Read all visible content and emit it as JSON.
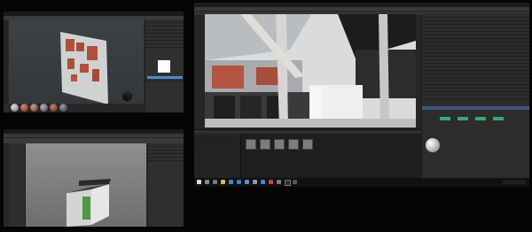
{
  "colors": {
    "desktop": "#050505",
    "panel": "#2b2b2b",
    "accent": "#4e88c9",
    "brick": "#b0503a"
  },
  "substance_window": {
    "material_balls": [
      "ball-1",
      "ball-2",
      "ball-3",
      "ball-4",
      "ball-5",
      "ball-6"
    ]
  },
  "render_window": {
    "asset_thumbnails": [
      "asset-1",
      "asset-2",
      "asset-3",
      "asset-4",
      "asset-5"
    ]
  },
  "taskbar": {
    "icons": [
      "windows-icon",
      "search-icon",
      "task-view-icon",
      "explorer-icon",
      "edge-icon",
      "store-icon",
      "mail-icon",
      "app-icon",
      "app-icon",
      "app-icon",
      "app-icon",
      "app-icon",
      "app-icon"
    ]
  }
}
